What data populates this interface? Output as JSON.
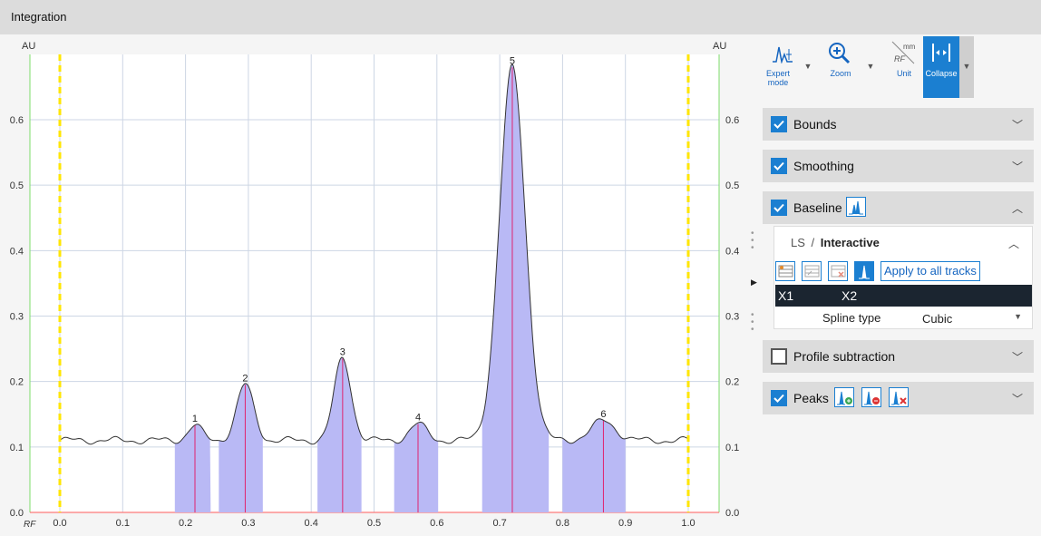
{
  "window": {
    "title": "Integration"
  },
  "toolbar": {
    "expert_mode": "Expert mode",
    "zoom": "Zoom",
    "unit": "Unit",
    "collapse": "Collapse"
  },
  "panels": {
    "bounds": "Bounds",
    "smoothing": "Smoothing",
    "baseline": "Baseline",
    "profile_subtraction": "Profile subtraction",
    "peaks": "Peaks"
  },
  "baseline_detail": {
    "mode_prefix": "LS",
    "separator": "/",
    "mode": "Interactive",
    "apply_all": "Apply to all tracks",
    "col_x1": "X1",
    "col_x2": "X2",
    "spline_label": "Spline type",
    "spline_value": "Cubic"
  },
  "colors": {
    "accent": "#1b7fd1",
    "peak_fill": "#b9b9f5",
    "peak_line": "#e0246e",
    "bound_line": "#ffe600",
    "axis_green": "#7ddc6a",
    "axis_red": "#ff5a5a"
  },
  "chart_data": {
    "type": "area",
    "y_unit_left": "AU",
    "y_unit_right": "AU",
    "x_unit": "RF",
    "xlim": [
      -0.05,
      1.05
    ],
    "ylim": [
      0.0,
      0.7
    ],
    "x_ticks": [
      "0.0",
      "0.1",
      "0.2",
      "0.3",
      "0.4",
      "0.5",
      "0.6",
      "0.7",
      "0.8",
      "0.9",
      "1.0"
    ],
    "y_ticks": [
      "0.0",
      "0.1",
      "0.2",
      "0.3",
      "0.4",
      "0.5",
      "0.6"
    ],
    "bounds": [
      0.0,
      1.0
    ],
    "baseline_level": 0.11,
    "peaks": [
      {
        "label": "1",
        "rf": 0.215,
        "height": 0.133,
        "start": 0.183,
        "end": 0.24
      },
      {
        "label": "2",
        "rf": 0.295,
        "height": 0.195,
        "start": 0.253,
        "end": 0.323
      },
      {
        "label": "3",
        "rf": 0.45,
        "height": 0.235,
        "start": 0.41,
        "end": 0.48
      },
      {
        "label": "4",
        "rf": 0.57,
        "height": 0.135,
        "start": 0.532,
        "end": 0.602
      },
      {
        "label": "5",
        "rf": 0.72,
        "height": 0.68,
        "start": 0.672,
        "end": 0.778
      },
      {
        "label": "6",
        "rf": 0.865,
        "height": 0.14,
        "start": 0.8,
        "end": 0.9
      }
    ]
  }
}
